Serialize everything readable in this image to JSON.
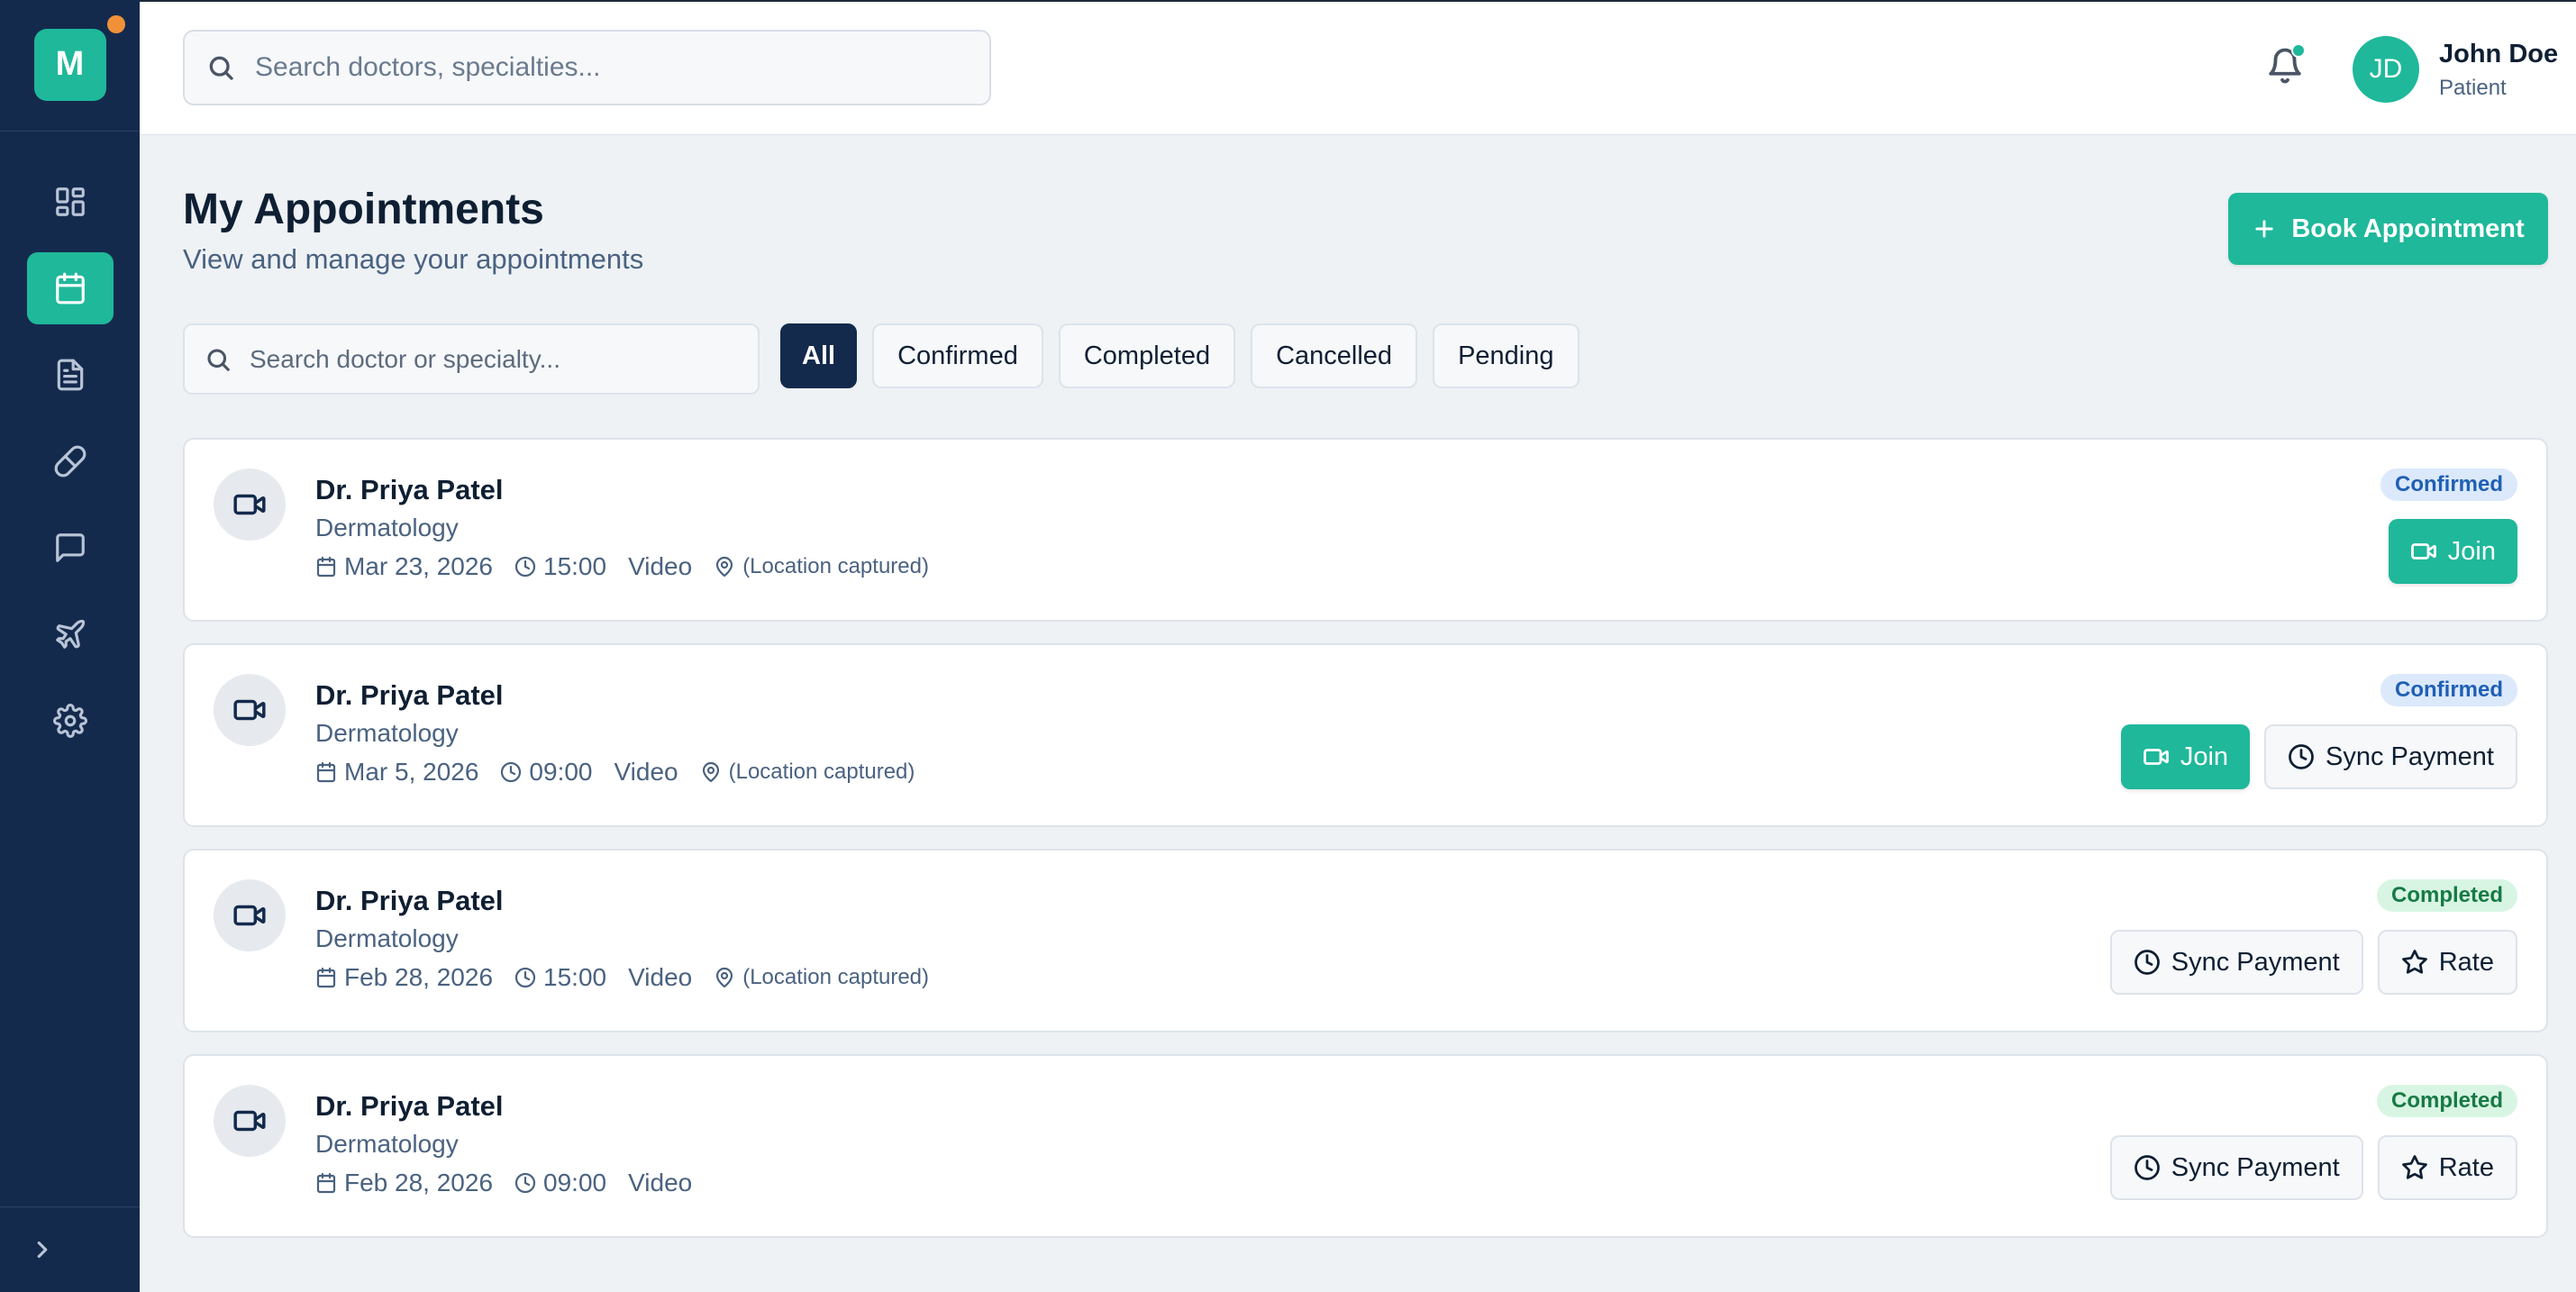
{
  "brand": {
    "logo_letter": "M",
    "accent": "#1fb89a",
    "sidebar_bg": "#142a4d"
  },
  "sidebar": {
    "items": [
      {
        "icon": "dashboard-icon",
        "active": false
      },
      {
        "icon": "calendar-icon",
        "active": true
      },
      {
        "icon": "document-icon",
        "active": false
      },
      {
        "icon": "pill-icon",
        "active": false
      },
      {
        "icon": "chat-icon",
        "active": false
      },
      {
        "icon": "plane-icon",
        "active": false
      },
      {
        "icon": "gear-icon",
        "active": false
      }
    ],
    "footer_icon": "chevron-right-icon"
  },
  "header": {
    "search_placeholder": "Search doctors, specialties...",
    "user": {
      "initials": "JD",
      "name": "John Doe",
      "role": "Patient"
    }
  },
  "page": {
    "title": "My Appointments",
    "subtitle": "View and manage your appointments",
    "book_button": "Book Appointment"
  },
  "filters": {
    "search_placeholder": "Search doctor or specialty...",
    "chips": [
      "All",
      "Confirmed",
      "Completed",
      "Cancelled",
      "Pending"
    ],
    "active": "All"
  },
  "appointments": [
    {
      "doctor": "Dr. Priya Patel",
      "specialty": "Dermatology",
      "date": "Mar 23, 2026",
      "time": "15:00",
      "type": "Video",
      "location": "(Location captured)",
      "status": "Confirmed",
      "actions": [
        "Join"
      ]
    },
    {
      "doctor": "Dr. Priya Patel",
      "specialty": "Dermatology",
      "date": "Mar 5, 2026",
      "time": "09:00",
      "type": "Video",
      "location": "(Location captured)",
      "status": "Confirmed",
      "actions": [
        "Join",
        "Sync Payment"
      ]
    },
    {
      "doctor": "Dr. Priya Patel",
      "specialty": "Dermatology",
      "date": "Feb 28, 2026",
      "time": "15:00",
      "type": "Video",
      "location": "(Location captured)",
      "status": "Completed",
      "actions": [
        "Sync Payment",
        "Rate"
      ]
    },
    {
      "doctor": "Dr. Priya Patel",
      "specialty": "Dermatology",
      "date": "Feb 28, 2026",
      "time": "09:00",
      "type": "Video",
      "location": "",
      "status": "Completed",
      "actions": [
        "Sync Payment",
        "Rate"
      ]
    }
  ]
}
